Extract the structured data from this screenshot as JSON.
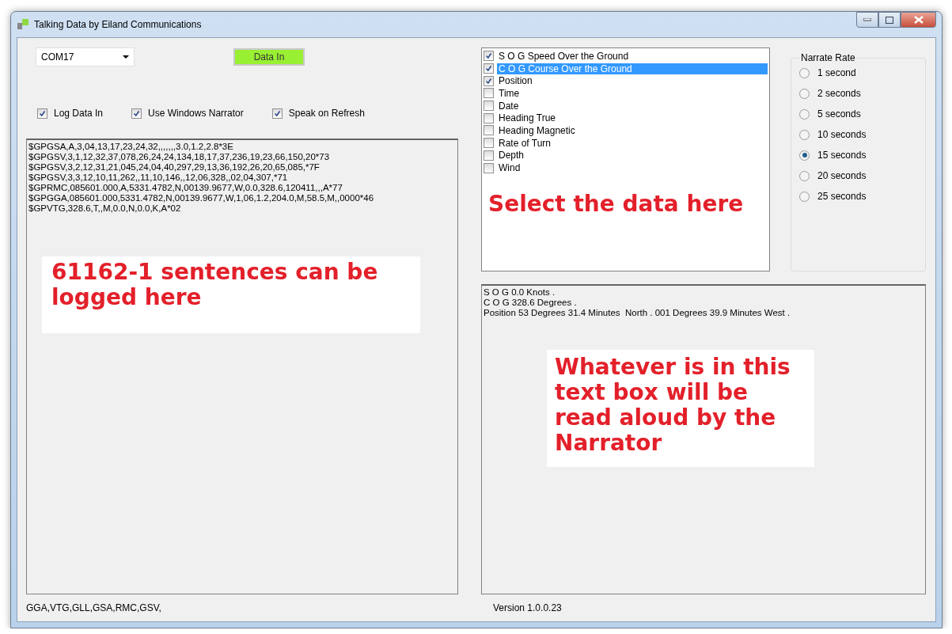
{
  "window": {
    "title": "Talking Data by Eiland Communications"
  },
  "port": {
    "value": "COM17"
  },
  "data_in_button": {
    "label": "Data In",
    "on": true
  },
  "options": [
    {
      "label": "Log Data In",
      "checked": true
    },
    {
      "label": "Use Windows Narrator",
      "checked": true
    },
    {
      "label": "Speak on Refresh",
      "checked": true
    }
  ],
  "log": [
    "$GPGSA,A,3,04,13,17,23,24,32,,,,,,,3.0,1.2,2.8*3E",
    "$GPGSV,3,1,12,32,37,078,26,24,24,134,18,17,37,236,19,23,66,150,20*73",
    "$GPGSV,3,2,12,31,21,045,24,04,40,297,29,13,36,192,26,20,65,085,*7F",
    "$GPGSV,3,3,12,10,11,262,,11,10,146,,12,06,328,,02,04,307,*71",
    "$GPRMC,085601.000,A,5331.4782,N,00139.9677,W,0.0,328.6,120411,,,A*77",
    "$GPGGA,085601.000,5331.4782,N,00139.9677,W,1,06,1.2,204.0,M,58.5,M,,0000*46",
    "$GPVTG,328.6,T,,M,0.0,N,0.0,K,A*02"
  ],
  "data_items": [
    {
      "label": "S O G Speed Over the Ground",
      "checked": true,
      "selected": false
    },
    {
      "label": "C O G Course Over the Ground",
      "checked": true,
      "selected": true
    },
    {
      "label": "Position",
      "checked": true,
      "selected": false
    },
    {
      "label": "Time",
      "checked": false,
      "selected": false
    },
    {
      "label": "Date",
      "checked": false,
      "selected": false
    },
    {
      "label": "Heading True",
      "checked": false,
      "selected": false
    },
    {
      "label": "Heading Magnetic",
      "checked": false,
      "selected": false
    },
    {
      "label": "Rate of Turn",
      "checked": false,
      "selected": false
    },
    {
      "label": "Depth",
      "checked": false,
      "selected": false
    },
    {
      "label": "Wind",
      "checked": false,
      "selected": false
    }
  ],
  "narrate_rate": {
    "title": "Narrate Rate",
    "options": [
      {
        "label": "1 second",
        "selected": false
      },
      {
        "label": "2 seconds",
        "selected": false
      },
      {
        "label": "5 seconds",
        "selected": false
      },
      {
        "label": "10 seconds",
        "selected": false
      },
      {
        "label": "15 seconds",
        "selected": true
      },
      {
        "label": "20 seconds",
        "selected": false
      },
      {
        "label": "25 seconds",
        "selected": false
      }
    ]
  },
  "narration": [
    "S O G 0.0 Knots .",
    "C O G 328.6 Degrees .",
    "Position 53 Degrees 31.4 Minutes  North . 001 Degrees 39.9 Minutes West ."
  ],
  "annotations": {
    "log": "61162-1 sentences can be logged here",
    "select": "Select the data here",
    "narration": "Whatever is in this text box will be read aloud by the Narrator"
  },
  "status_bar": {
    "sentences": "GGA,VTG,GLL,GSA,RMC,GSV,",
    "version": "Version 1.0.0.23"
  }
}
